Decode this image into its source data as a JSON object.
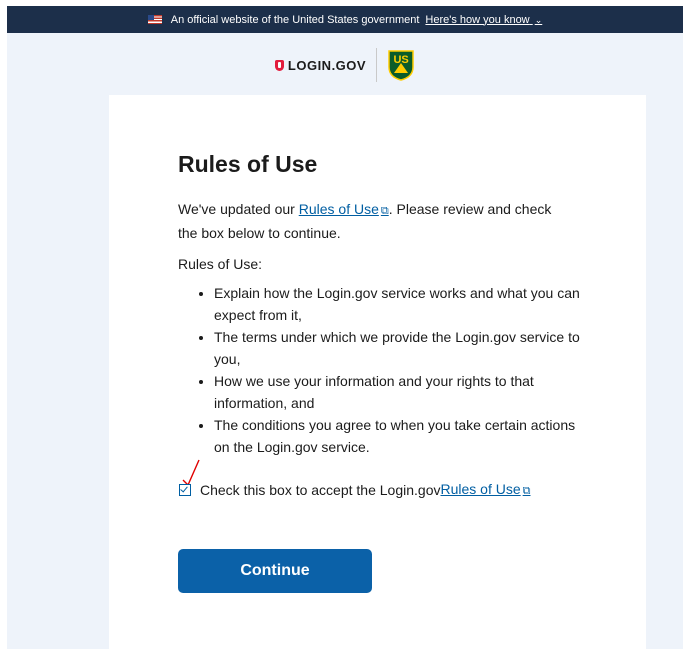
{
  "banner": {
    "text": "An official website of the United States government",
    "link": "Here's how you know",
    "chevron": "⌄"
  },
  "header": {
    "login_logo": "LOGIN.GOV",
    "agency_logo": "US"
  },
  "main": {
    "title": "Rules of Use",
    "intro_before": "We've updated our ",
    "intro_link": "Rules of Use",
    "intro_after": ". Please review and check the box below to continue.",
    "rules_label": "Rules of Use:",
    "rules": [
      "Explain how the Login.gov service works and what you can expect from it,",
      "The terms under which we provide the Login.gov service to you,",
      "How we use your information and your rights to that information, and",
      "The conditions you agree to when you take certain actions on the Login.gov service."
    ],
    "checkbox_text": "Check this box to accept the Login.gov ",
    "checkbox_link": "Rules of Use",
    "checkbox_checked": true,
    "continue_label": "Continue",
    "external_icon": "⧉"
  },
  "colors": {
    "banner_bg": "#1c2f4a",
    "link": "#005ea2",
    "button_bg": "#0b61a8",
    "page_bg": "#eef3fa",
    "annotation": "#e00000"
  }
}
